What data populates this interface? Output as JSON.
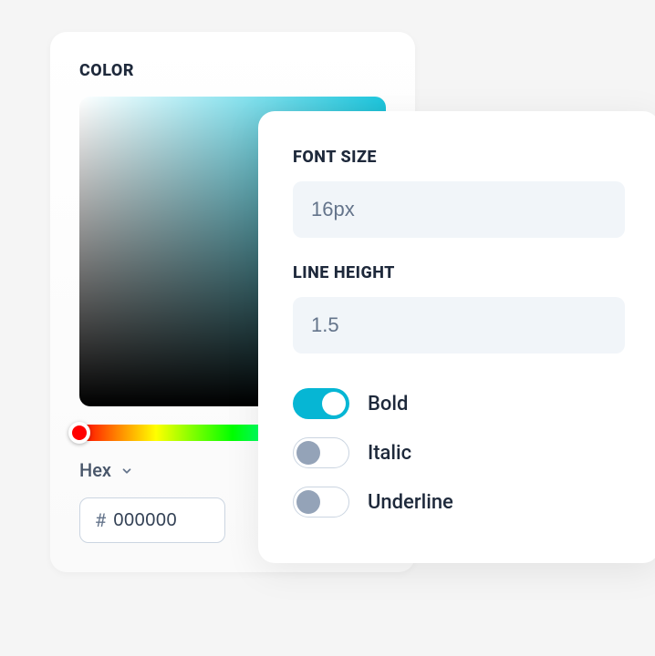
{
  "color_panel": {
    "title": "COLOR",
    "format_label": "Hex",
    "hex_prefix": "#",
    "hex_value": "000000",
    "selected_hue": "#1dc8df"
  },
  "font_panel": {
    "font_size_title": "FONT SIZE",
    "font_size_value": "16px",
    "line_height_title": "LINE HEIGHT",
    "line_height_value": "1.5",
    "toggles": {
      "bold": {
        "label": "Bold",
        "enabled": true
      },
      "italic": {
        "label": "Italic",
        "enabled": false
      },
      "underline": {
        "label": "Underline",
        "enabled": false
      }
    }
  },
  "colors": {
    "accent": "#06b6d4",
    "text_dark": "#1e293b",
    "text_muted": "#64748b"
  }
}
